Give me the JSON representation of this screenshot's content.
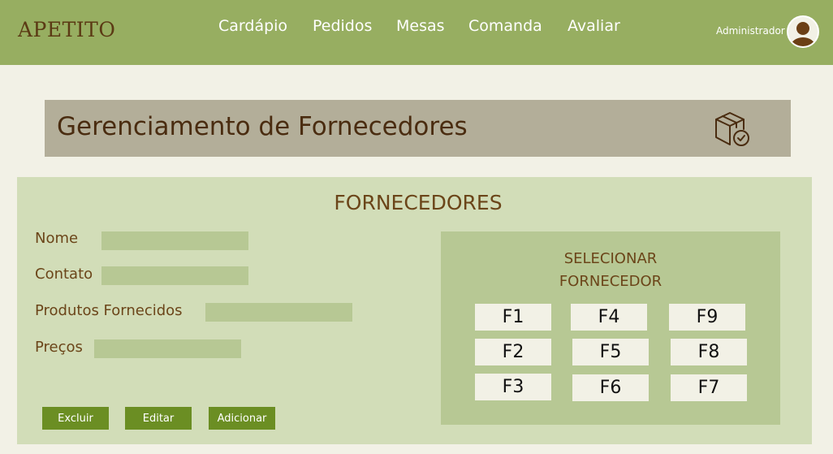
{
  "header": {
    "brand": "APETITO",
    "nav": [
      "Cardápio",
      "Pedidos",
      "Mesas",
      "Comanda",
      "Avaliar"
    ],
    "user_label": "Administrador"
  },
  "page": {
    "title": "Gerenciamento de Fornecedores",
    "icon": "box-check-icon"
  },
  "form": {
    "section_title": "FORNECEDORES",
    "fields": [
      {
        "label": "Nome",
        "value": ""
      },
      {
        "label": "Contato",
        "value": ""
      },
      {
        "label": "Produtos Fornecidos",
        "value": ""
      },
      {
        "label": "Preços",
        "value": ""
      }
    ],
    "buttons": {
      "delete": "Excluir",
      "edit": "Editar",
      "add": "Adicionar"
    }
  },
  "selector": {
    "title_line1": "SELECIONAR",
    "title_line2": "FORNECEDOR",
    "suppliers": [
      "F1",
      "F4",
      "F9",
      "F2",
      "F5",
      "F8",
      "F3",
      "F6",
      "F7"
    ]
  },
  "colors": {
    "header": "#97ae61",
    "banner": "#b3ae99",
    "panel": "#d2ddb8",
    "input": "#b7c894",
    "button": "#6b8e23",
    "text_brown": "#6b4519"
  }
}
